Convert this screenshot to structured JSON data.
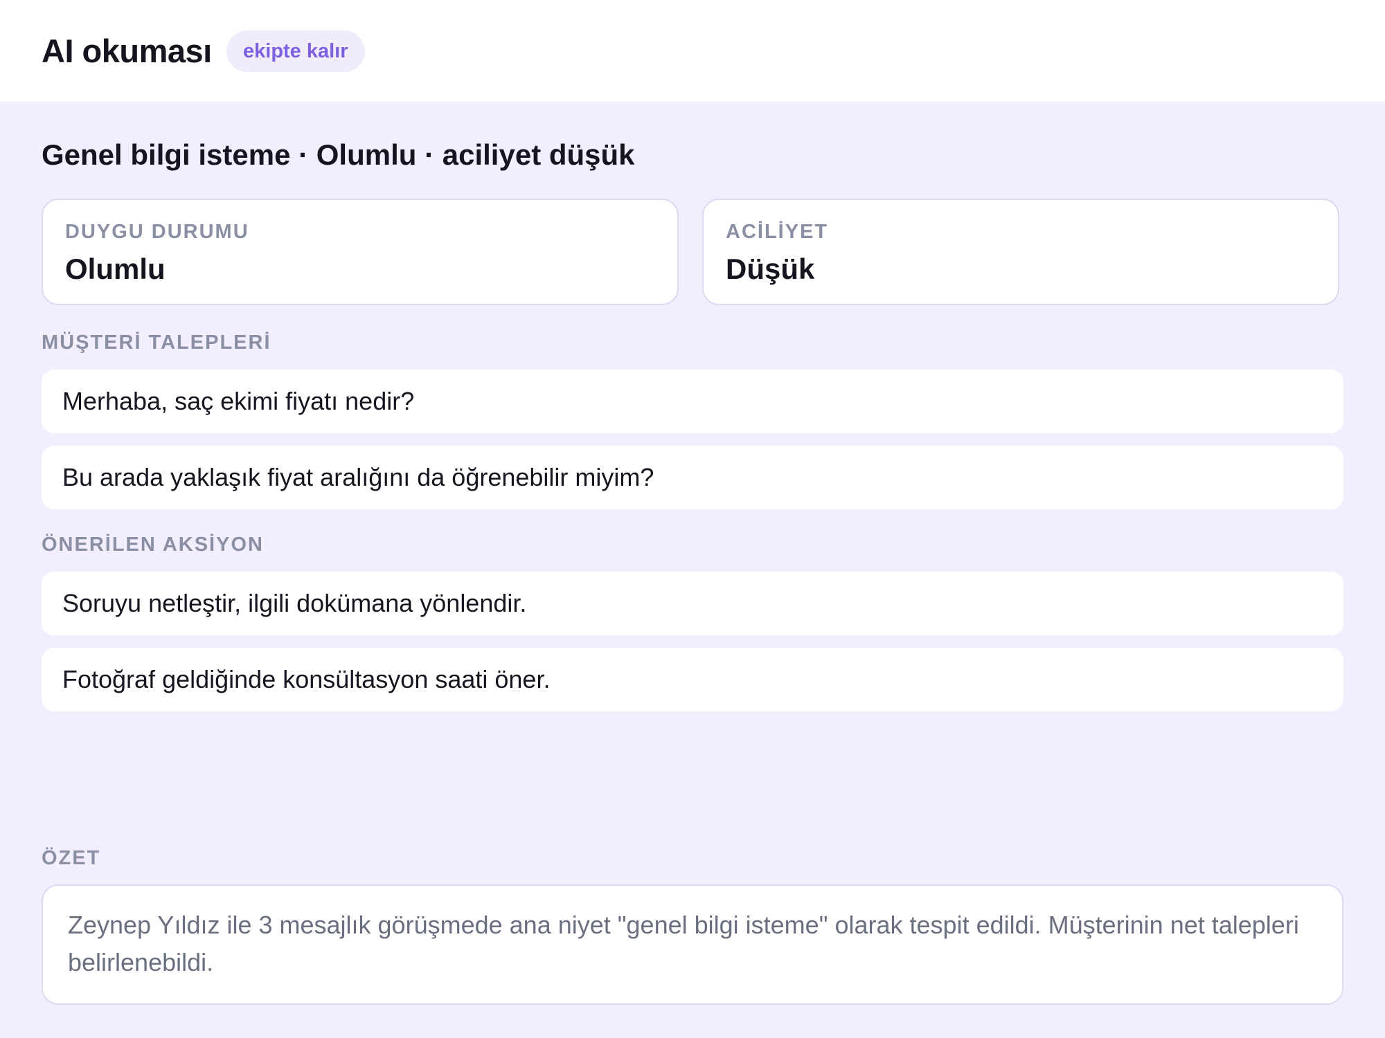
{
  "header": {
    "title": "AI okuması",
    "badge": "ekipte kalır"
  },
  "main": {
    "heading": "Genel bilgi isteme · Olumlu · aciliyet düşük",
    "sentiment": {
      "label": "DUYGU DURUMU",
      "value": "Olumlu"
    },
    "urgency": {
      "label": "ACİLİYET",
      "value": "Düşük"
    },
    "requests": {
      "label": "MÜŞTERİ TALEPLERİ",
      "items": [
        "Merhaba, saç ekimi fiyatı nedir?",
        "Bu arada yaklaşık fiyat aralığını da öğrenebilir miyim?"
      ]
    },
    "actions": {
      "label": "ÖNERİLEN AKSİYON",
      "items": [
        "Soruyu netleştir, ilgili dokümana yönlendir.",
        "Fotoğraf geldiğinde konsültasyon saati öner."
      ]
    },
    "summary": {
      "label": "ÖZET",
      "text": "Zeynep Yıldız ile 3 mesajlık görüşmede ana niyet \"genel bilgi isteme\" olarak tespit edildi. Müşterinin net talepleri belirlenebildi."
    }
  }
}
